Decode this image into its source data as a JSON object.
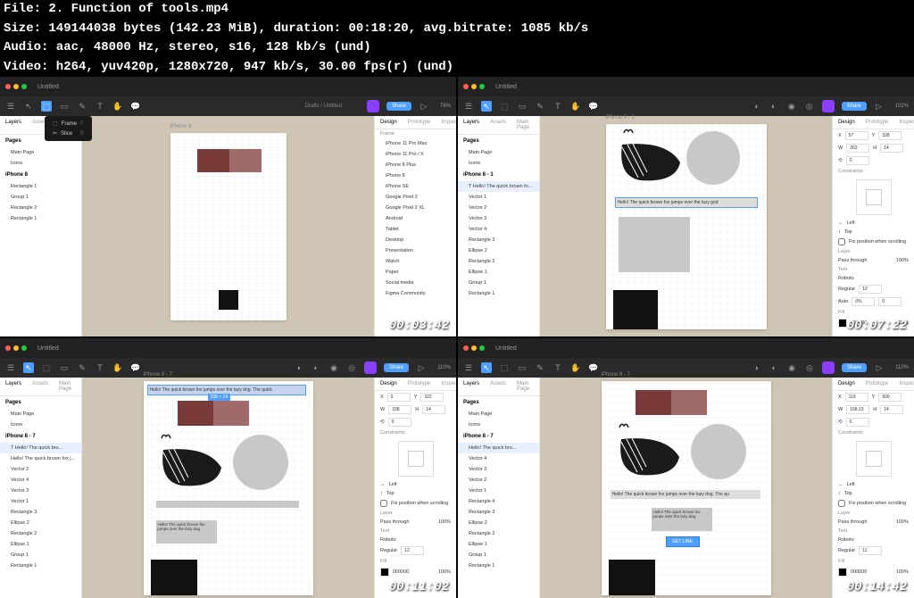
{
  "meta": {
    "file": "File: 2. Function of tools.mp4",
    "size": "Size: 149144038 bytes (142.23 MiB), duration: 00:18:20, avg.bitrate: 1085 kb/s",
    "audio": "Audio: aac, 48000 Hz, stereo, s16, 128 kb/s (und)",
    "video": "Video: h264, yuv420p, 1280x720, 947 kb/s, 30.00 fps(r) (und)"
  },
  "common": {
    "title": "Untitled",
    "share": "Share",
    "layers_tab": "Layers",
    "assets_tab": "Assets",
    "main_page": "Main Page",
    "pages": "Pages",
    "icons": "Icons",
    "design_tab": "Design",
    "prototype_tab": "Prototype",
    "inspect_tab": "Inspect",
    "frame_section": "Frame",
    "constraints": "Constraints",
    "left": "Left",
    "top": "Top",
    "fix_scroll": "Fix position when scrolling",
    "layer": "Layer",
    "pass_through": "Pass through",
    "fill": "Fill",
    "text_section": "Text",
    "roboto": "Roboto",
    "regular": "Regular",
    "auto": "Auto",
    "pct100": "100%",
    "pct0": "0%",
    "drafts": "Drafts",
    "untitled": "Untitled",
    "zoom110": "110%",
    "zoom102": "102%"
  },
  "t1": {
    "timestamp": "00:03:42",
    "dd_frame": "Frame",
    "dd_slice": "Slice",
    "dd_key_f": "F",
    "dd_key_s": "S",
    "iphone8": "iPhone 8",
    "layers": [
      "Rectangle 1",
      "Group 1",
      "Rectangle 2",
      "Rectangle 1"
    ],
    "devices": [
      "iPhone 11 Pro Max",
      "iPhone 11 Pro / X",
      "iPhone 8 Plus",
      "iPhone 8",
      "iPhone SE",
      "Google Pixel 2",
      "Google Pixel 2 XL",
      "Android",
      "Tablet",
      "Desktop",
      "Presentation",
      "Watch",
      "Paper",
      "Social media",
      "Figma Community"
    ]
  },
  "t2": {
    "timestamp": "00:07:22",
    "iphone": "iPhone 8 - 1",
    "sel_layer": "T  Hello! The quick brown fox ju...",
    "hello_text": "Hello! The quick brown fox jumps over the lazy god",
    "layers": [
      "Vector 1",
      "Vector 2",
      "Vector 3",
      "Vector 4",
      "Rectangle 3",
      "Ellipse 2",
      "Rectangle 2",
      "Ellipse 1",
      "Group 1",
      "Rectangle 1"
    ],
    "x": "57",
    "y": "328",
    "w": "263",
    "h": "14",
    "r": "0",
    "tsize": "12",
    "lh": "0%",
    "ls": "0"
  },
  "t3": {
    "timestamp": "00:11:02",
    "iphone": "iPhone 8 - 7",
    "sel_layer": "T  Hello! The quick bro...",
    "top_text": "Hello! The quick brown fox jumps over the lazy dog.   The quick",
    "box_text": "Hello! The quick brown fox jumps over the lazy dog",
    "layers": [
      "Hello! The quick brown fox j...",
      "Vector 2",
      "Vector 4",
      "Vector 3",
      "Vector 1",
      "Rectangle 3",
      "Ellipse 2",
      "Rectangle 2",
      "Ellipse 1",
      "Group 1",
      "Rectangle 1"
    ],
    "x": "0",
    "y": "322",
    "w": "338",
    "h": "14",
    "r": "0",
    "tsize": "12"
  },
  "t4": {
    "timestamp": "00:14:42",
    "iphone": "iPhone 8 - 7",
    "sel_layer": "Hello! The quick bro...",
    "mid_text": "Hello! The quick brown fox jumps over the lazy dog.   The qu",
    "box_text": "Hello! The quick brown fox jumps over the lazy dog.",
    "btn": "GET LINK",
    "layers": [
      "Vector 4",
      "Vector 3",
      "Vector 2",
      "Vector 1",
      "Rectangle 4",
      "Rectangle 3",
      "Ellipse 2",
      "Rectangle 2",
      "Ellipse 1",
      "Group 1",
      "Rectangle 1"
    ],
    "x": "119",
    "y": "509",
    "w": "168.13",
    "h": "14",
    "r": "0",
    "tsize": "11"
  }
}
